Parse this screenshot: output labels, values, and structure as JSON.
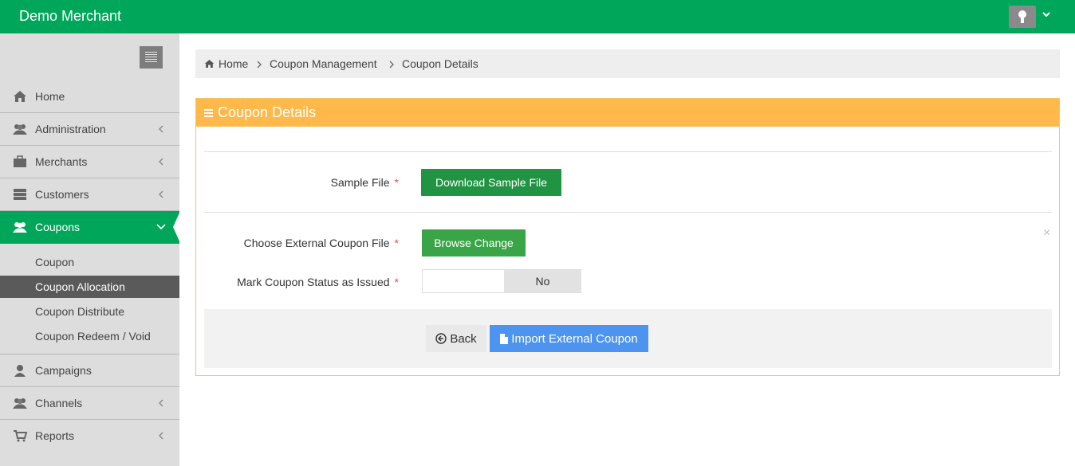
{
  "header": {
    "brand": "Demo Merchant",
    "avatar_icon": "user-avatar-icon",
    "caret_icon": "chevron-down-icon"
  },
  "sidebar": {
    "toggle_icon": "hamburger-icon",
    "items": [
      {
        "label": "Home",
        "icon": "home-icon"
      },
      {
        "label": "Administration",
        "icon": "users-icon"
      },
      {
        "label": "Merchants",
        "icon": "briefcase-icon"
      },
      {
        "label": "Customers",
        "icon": "server-icon"
      },
      {
        "label": "Coupons",
        "icon": "users-icon"
      },
      {
        "label": "Campaigns",
        "icon": "user-icon"
      },
      {
        "label": "Channels",
        "icon": "users-icon"
      },
      {
        "label": "Reports",
        "icon": "cart-icon"
      }
    ],
    "coupon_sub": [
      {
        "label": "Coupon"
      },
      {
        "label": "Coupon Allocation"
      },
      {
        "label": "Coupon Distribute"
      },
      {
        "label": "Coupon Redeem / Void"
      }
    ]
  },
  "breadcrumb": {
    "home": "Home",
    "level1": "Coupon Management",
    "level2": "Coupon Details"
  },
  "panel": {
    "title": "Coupon Details",
    "sample_file_label": "Sample File",
    "download_label": "Download Sample File",
    "choose_file_label": "Choose External Coupon File",
    "browse_label": "Browse Change",
    "close_symbol": "×",
    "mark_issued_label": "Mark Coupon Status as Issued",
    "toggle_value": "No",
    "required_mark": "*",
    "back_label": "Back",
    "import_label": "Import External Coupon"
  },
  "colors": {
    "brand_green": "#00a65a",
    "panel_orange": "#ffb84a",
    "primary_blue": "#4d94f0"
  }
}
